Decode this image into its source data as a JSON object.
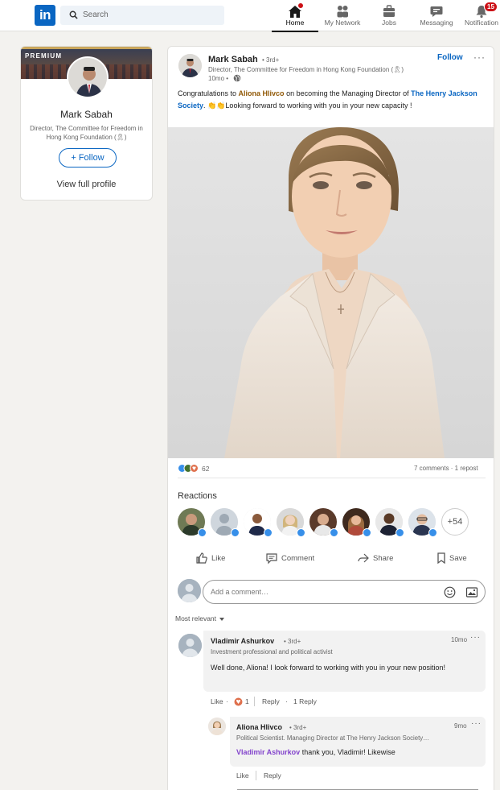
{
  "nav": {
    "search_placeholder": "Search",
    "items": [
      {
        "label": "Home",
        "icon": "home-icon",
        "active": true
      },
      {
        "label": "My Network",
        "icon": "network-icon"
      },
      {
        "label": "Jobs",
        "icon": "jobs-icon"
      },
      {
        "label": "Messaging",
        "icon": "messaging-icon"
      },
      {
        "label": "Notification",
        "icon": "bell-icon",
        "badge": "15"
      }
    ]
  },
  "profile_card": {
    "premium_label": "PREMIUM",
    "name": "Mark Sabah",
    "headline": "Director, The Committee for Freedom in Hong Kong Foundation (🎗)",
    "follow_label": "+ Follow",
    "view_profile_label": "View full profile"
  },
  "post": {
    "author_name": "Mark Sabah",
    "author_degree": "• 3rd+",
    "author_headline": "Director, The Committee for Freedom in Hong Kong Foundation (🎗)",
    "time": "10mo •",
    "follow_label": "Follow",
    "more_label": "···",
    "text": {
      "prefix": "Congratulations to ",
      "mention_person": "Aliona Hlivco",
      "middle": " on becoming the Managing Director of ",
      "mention_org": "The Henry Jackson Society",
      "suffix": ". 👏👏Looking forward to working with you in your new capacity !"
    },
    "reaction_count": "62",
    "comments_reposts": "7 comments · 1 repost",
    "reactions_title": "Reactions",
    "more_reactors": "+54",
    "actions": {
      "like": "Like",
      "comment": "Comment",
      "share": "Share",
      "save": "Save"
    },
    "comment_placeholder": "Add a comment…",
    "sort_label": "Most relevant"
  },
  "comments": [
    {
      "name": "Vladimir Ashurkov",
      "degree": "• 3rd+",
      "headline": "Investment professional and political activist",
      "time": "10mo",
      "body": "Well done, Aliona! I look forward to working with you in your new position!",
      "like_label": "Like",
      "reaction_count": "1",
      "reply_label": "Reply",
      "replies_label": "1 Reply"
    },
    {
      "name": "Aliona Hlivco",
      "degree": "• 3rd+",
      "headline": "Political Scientist. Managing Director at The Henry Jackson Society…",
      "time": "9mo",
      "mention": "Vladimir Ashurkov",
      "body": " thank you, Vladimir! Likewise",
      "like_label": "Like",
      "reply_label": "Reply"
    }
  ],
  "colors": {
    "linkedin_blue": "#0a66c2",
    "badge_red": "#cc1016",
    "premium_gold": "#c9a65b"
  }
}
